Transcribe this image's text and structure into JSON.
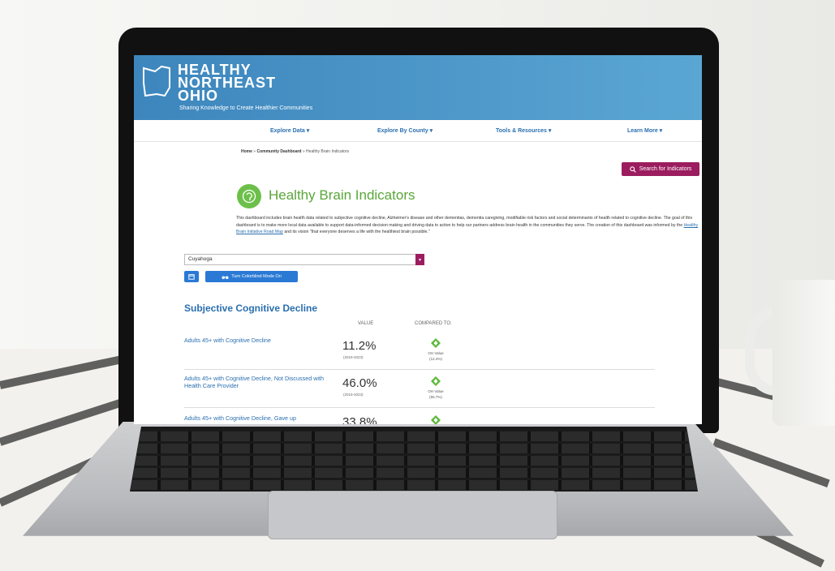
{
  "site": {
    "brand_lines": [
      "HEALTHY",
      "NORTHEAST",
      "OHIO"
    ],
    "tagline": "Sharing Knowledge to Create Healthier Communities"
  },
  "nav": {
    "items": [
      "Explore Data ▾",
      "Explore By County ▾",
      "Tools & Resources ▾",
      "Learn More ▾"
    ]
  },
  "breadcrumb": {
    "home": "Home",
    "sep": " » ",
    "dashboard": "Community Dashboard",
    "current": "Healthy Brain Indicators"
  },
  "search_button": "Search for Indicators",
  "page": {
    "title": "Healthy Brain Indicators",
    "description_before": "This dashboard includes brain health data related to subjective cognitive decline, Alzheimer's disease and other dementias, dementia caregiving, modifiable risk factors and social determinants of health related to cognitive decline. The goal of this dashboard is to make more local data available to support data-informed decision making and driving data to action to help our partners address brain health in the communities they serve. The creation of this dashboard was informed by the ",
    "description_link": "Healthy Brain Initiative Road Map",
    "description_after": " and its vision \"that everyone deserves a life with the healthiest brain possible.\""
  },
  "controls": {
    "county_selected": "Cuyahoga",
    "colorblind_button": "Turn Colorblind Mode On"
  },
  "section": {
    "title": "Subjective Cognitive Decline",
    "col_value": "VALUE",
    "col_compared": "COMPARED TO:"
  },
  "rows": [
    {
      "label": "Adults 45+ with Cognitive Decline",
      "value": "11.2%",
      "years": "(2019-2023)",
      "cmp_label": "OH Value",
      "cmp_value": "(12.4%)"
    },
    {
      "label": "Adults 45+ with Cognitive Decline, Not Discussed with Health Care Provider",
      "value": "46.0%",
      "years": "(2019-2023)",
      "cmp_label": "OH Value",
      "cmp_value": "(55.7%)"
    },
    {
      "label": "Adults 45+ with Cognitive Decline, Gave up",
      "value": "33.8%",
      "years": "",
      "cmp_label": "",
      "cmp_value": ""
    }
  ],
  "colors": {
    "header_blue": "#3d86bd",
    "accent_magenta": "#9b1d5f",
    "title_green": "#5aa63a",
    "link_blue": "#2a6fb0",
    "button_blue": "#2a7ad5"
  }
}
